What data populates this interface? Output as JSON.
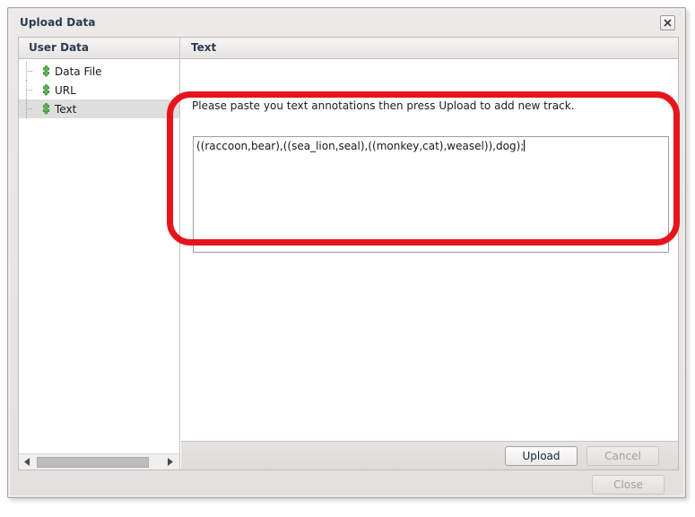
{
  "window": {
    "title": "Upload Data",
    "close_icon": "close-x-icon"
  },
  "columns": {
    "left_header": "User Data",
    "right_header": "Text"
  },
  "sidebar": {
    "items": [
      {
        "label": "Data File",
        "icon": "puzzle-piece-icon",
        "selected": false
      },
      {
        "label": "URL",
        "icon": "puzzle-piece-icon",
        "selected": false
      },
      {
        "label": "Text",
        "icon": "puzzle-piece-icon",
        "selected": true
      }
    ],
    "scrollbar": {
      "left_arrow_icon": "triangle-left-icon",
      "right_arrow_icon": "triangle-right-icon"
    }
  },
  "content": {
    "instruction": "Please paste you text annotations then press Upload to add new track.",
    "textarea": {
      "value": "((raccoon,bear),((sea_lion,seal),((monkey,cat),weasel)),dog);",
      "placeholder": ""
    }
  },
  "buttons": {
    "upload": {
      "label": "Upload",
      "enabled": true
    },
    "cancel": {
      "label": "Cancel",
      "enabled": false
    },
    "close": {
      "label": "Close",
      "enabled": false
    }
  },
  "annotation": {
    "highlight_color": "#e8141c",
    "shape": "rounded-rectangle"
  }
}
